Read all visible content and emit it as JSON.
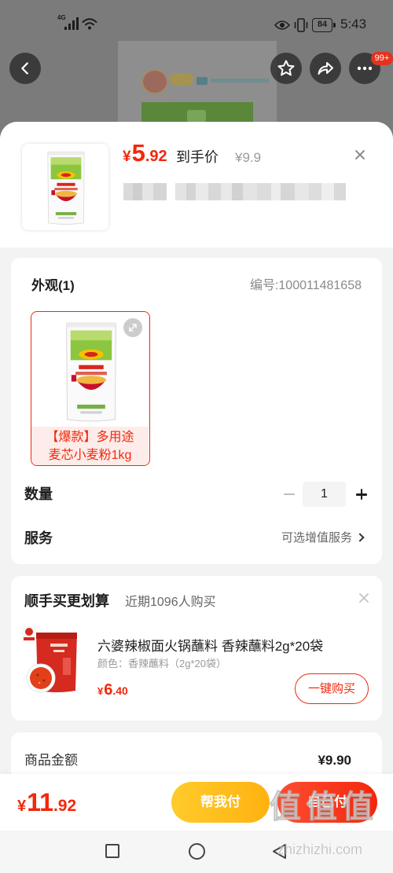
{
  "status_bar": {
    "network": "4G",
    "battery": "84",
    "time": "5:43"
  },
  "background_page": {
    "more_badge": "99+"
  },
  "sheet": {
    "header": {
      "price": {
        "currency": "¥",
        "integer": "5",
        "decimal": ".92"
      },
      "price_label": "到手价",
      "original_price": "¥9.9"
    },
    "options": {
      "appearance_label": "外观(1)",
      "sku_label": "编号:100011481658",
      "variants": [
        {
          "label_line1": "【爆款】多用途",
          "label_line2": "麦芯小麦粉1kg",
          "selected": true
        }
      ],
      "quantity_label": "数量",
      "quantity_value": "1",
      "service_label": "服务",
      "service_value": "可选增值服务"
    },
    "addon": {
      "title": "顺手买更划算",
      "subtitle": "近期1096人购买",
      "product": {
        "name": "六婆辣椒面火锅蘸料 香辣蘸料2g*20袋",
        "spec": "颜色：香辣蘸料（2g*20袋）",
        "price": {
          "currency": "¥",
          "integer": "6",
          "decimal": ".40"
        },
        "buy_button": "一键购买"
      }
    },
    "summary": {
      "label": "商品金额",
      "value": "¥9.90"
    }
  },
  "footer": {
    "total": {
      "currency": "¥",
      "integer": "11",
      "decimal": ".92"
    },
    "help_pay_button": "帮我付",
    "self_pay_button": "自己付"
  },
  "watermark": {
    "mark": "值值值",
    "site": "zhizhizhi.com"
  },
  "icons": {
    "status": [
      "signal-icon",
      "wifi-icon",
      "eye-icon",
      "vibrate-icon",
      "battery-icon"
    ],
    "top_nav": [
      "back-icon",
      "star-icon",
      "share-icon",
      "more-icon"
    ],
    "sheet": [
      "close-icon",
      "expand-icon",
      "minus-icon",
      "plus-icon",
      "chevron-right-icon"
    ],
    "system_nav": [
      "recents-icon",
      "home-icon",
      "back-triangle-icon"
    ]
  },
  "colors": {
    "accent": "#f2270c",
    "help_pay_start": "#ffcb2b",
    "help_pay_end": "#ffb210",
    "self_pay_start": "#ff4d31",
    "self_pay_end": "#f2270c",
    "dim_overlay": "#7b7b7b",
    "sheet_bg": "#f3f3f3"
  }
}
